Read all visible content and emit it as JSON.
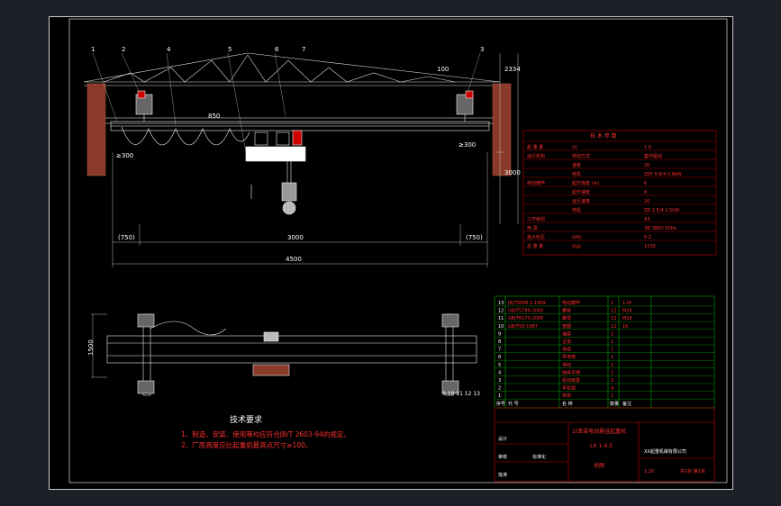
{
  "dimensions": {
    "span_total": "4500",
    "span_mid": "3000",
    "left_clear": "(750)",
    "right_clear": "(750)",
    "clear_left": "≥300",
    "clear_right": "≥300",
    "hook_height": "1500",
    "top_clear": "100",
    "right_height": "2334",
    "col_height": "3000",
    "dim_850": "850"
  },
  "balloons": [
    "1",
    "2",
    "3",
    "4",
    "5",
    "6",
    "7"
  ],
  "section_marks": "9 10 11 12 13",
  "tech": {
    "title": "技术要求",
    "line1": "1、制造、安装、使用等均应符合JB/T 2603-94的规定。",
    "line2": "2、厂房高度应比起重机最高点尺寸≥100。"
  },
  "params": {
    "title": "技  术  参  数",
    "rows": [
      [
        "起  重  量",
        "(t)",
        "1.0"
      ],
      [
        "运行机构",
        "传动方式",
        "集中驱动"
      ],
      [
        "",
        "速度",
        "20"
      ],
      [
        "",
        "电机",
        "ZDY 0.8/4 0.8kW"
      ],
      [
        "电动葫芦",
        "起升高度 (m)",
        "6"
      ],
      [
        "",
        "起升速度",
        "8"
      ],
      [
        "",
        "运行速度",
        "20"
      ],
      [
        "",
        "电机",
        "ZD 1.5/4 1.5kW"
      ],
      [
        "工作级别",
        "",
        "A3"
      ],
      [
        "电 源",
        "",
        "3Φ 380V 50Hz"
      ],
      [
        "最大轮压",
        "(kN)",
        "6.2"
      ],
      [
        "总 重 量",
        "(kg)",
        "1150"
      ]
    ]
  },
  "bom": {
    "rows": [
      [
        "13",
        "JB/T9008.1-1999",
        "电动葫芦",
        "1",
        "1.0t"
      ],
      [
        "12",
        "GB/T5780-2000",
        "螺栓",
        "12",
        "M16"
      ],
      [
        "11",
        "GB/T6170-2000",
        "螺母",
        "12",
        "M16"
      ],
      [
        "10",
        "GB/T93-1987",
        "垫圈",
        "12",
        "16"
      ],
      [
        "9",
        "",
        "端梁",
        "2",
        ""
      ],
      [
        "8",
        "",
        "主梁",
        "1",
        ""
      ],
      [
        "7",
        "",
        "电缆",
        "1",
        ""
      ],
      [
        "6",
        "",
        "导电架",
        "1",
        ""
      ],
      [
        "5",
        "",
        "滑线",
        "1",
        ""
      ],
      [
        "4",
        "",
        "操纵手柄",
        "1",
        ""
      ],
      [
        "3",
        "",
        "驱动装置",
        "2",
        ""
      ],
      [
        "2",
        "",
        "车轮组",
        "4",
        ""
      ],
      [
        "1",
        "",
        "桥架",
        "1",
        ""
      ]
    ],
    "header": [
      "序号",
      "代  号",
      "名  称",
      "数量",
      "备注"
    ]
  },
  "title_block": {
    "drawing_name": "1t单梁电动悬挂起重机",
    "code": "LX 1-4.5",
    "sheet_label": "总图",
    "company": "XX起重机械有限公司",
    "scale": "1:20",
    "sheet": "共1张 第1张",
    "design": "设计",
    "check": "审核",
    "approve": "批准",
    "standard": "标准化"
  }
}
